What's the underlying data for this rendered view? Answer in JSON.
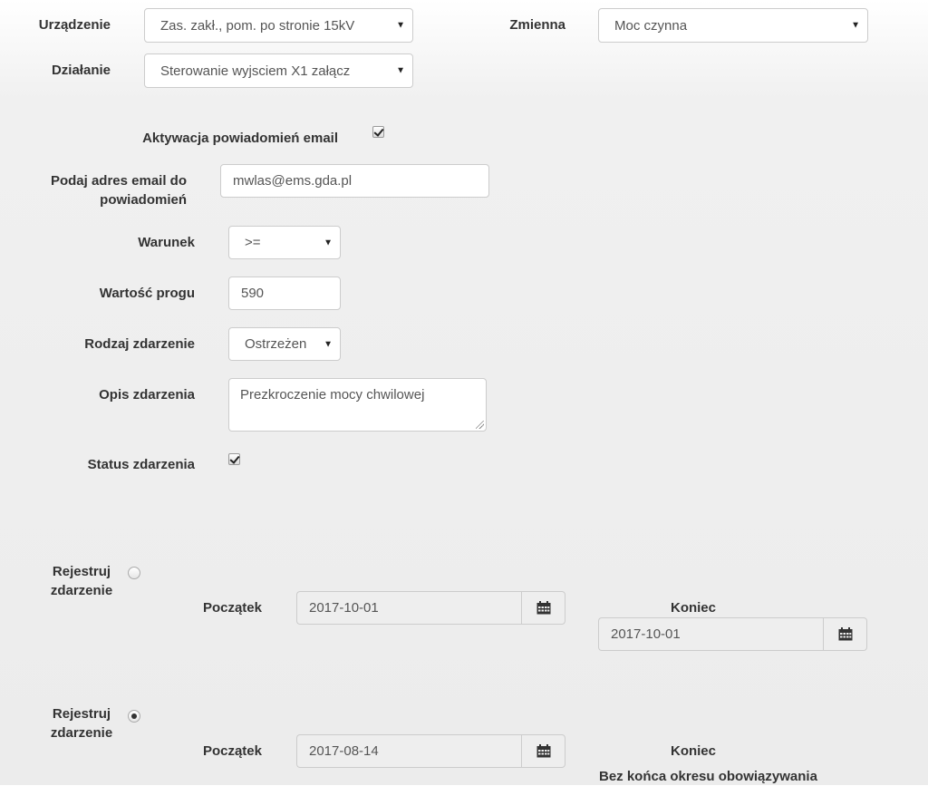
{
  "device": {
    "label": "Urządzenie",
    "value": "Zas. zakł., pom. po stronie 15kV"
  },
  "variable": {
    "label": "Zmienna",
    "value": "Moc czynna"
  },
  "action": {
    "label": "Działanie",
    "value": "Sterowanie wyjsciem X1 załącz"
  },
  "email_activation": {
    "label": "Aktywacja powiadomień email",
    "checked": true
  },
  "email": {
    "label_line1": "Podaj adres email do",
    "label_line2": "powiadomień",
    "value": "mwlas@ems.gda.pl"
  },
  "condition": {
    "label": "Warunek",
    "value": ">="
  },
  "threshold": {
    "label": "Wartość progu",
    "value": "590"
  },
  "event_type": {
    "label": "Rodzaj zdarzenie",
    "value": "Ostrzeżen"
  },
  "event_desc": {
    "label": "Opis zdarzenia",
    "value": "Prezkroczenie mocy chwilowej"
  },
  "event_status": {
    "label": "Status zdarzenia",
    "checked": true
  },
  "register1": {
    "label_line1": "Rejestruj",
    "label_line2": "zdarzenie",
    "selected": false,
    "start_label": "Początek",
    "start_value": "2017-10-01",
    "end_label": "Koniec",
    "end_value": "2017-10-01"
  },
  "register2": {
    "label_line1": "Rejestruj",
    "label_line2": "zdarzenie",
    "selected": true,
    "start_label": "Początek",
    "start_value": "2017-08-14",
    "end_label": "Koniec",
    "end_text": "Bez końca okresu obowiązywania"
  },
  "icons": {
    "caret": "triangle-down",
    "calendar": "calendar-icon"
  }
}
